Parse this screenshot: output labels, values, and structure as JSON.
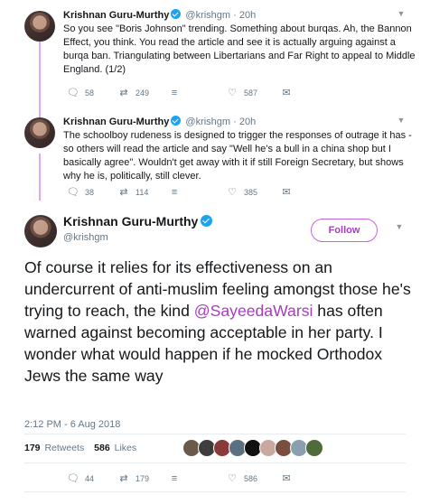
{
  "tweets": [
    {
      "name": "Krishnan Guru-Murthy",
      "handle": "@krishgm",
      "time": "20h",
      "text": "So you see \"Boris Johnson\" trending. Something about burqas. Ah, the Bannon Effect, you think. You read the article and see it is actually arguing against a burqa ban. Triangulating between Libertarians and Far Right to appeal to Middle England. (1/2)",
      "replies": "58",
      "retweets": "249",
      "likes": "587"
    },
    {
      "name": "Krishnan Guru-Murthy",
      "handle": "@krishgm",
      "time": "20h",
      "text": "The schoolboy rudeness is designed to trigger the responses of outrage it has - so others will read the article and say \"Well he's a bull in a china shop but I basically agree\". Wouldn't get away with it if still Foreign Secretary, but shows why he is, politically, still clever.",
      "replies": "38",
      "retweets": "114",
      "likes": "385"
    }
  ],
  "main": {
    "name": "Krishnan Guru-Murthy",
    "handle": "@krishgm",
    "follow_label": "Follow",
    "text_before": "Of course it relies for its effectiveness on an undercurrent of anti-muslim feeling amongst those he's trying to reach, the kind ",
    "mention": "@SayeedaWarsi",
    "text_after": " has often warned against becoming acceptable in her party. I wonder what would happen if he mocked Orthodox Jews the same way",
    "timestamp": "2:12 PM - 6 Aug 2018",
    "retweets_count": "179",
    "retweets_label": "Retweets",
    "likes_count": "586",
    "likes_label": "Likes",
    "replies": "44",
    "retweets": "179",
    "likes": "586"
  },
  "icons": {
    "reply": "reply-icon",
    "retweet": "retweet-icon",
    "like": "heart-icon",
    "dm": "stack-icon",
    "mail": "envelope-icon",
    "caret": "chevron-down-icon",
    "verified": "verified-badge-icon"
  },
  "colors": {
    "accent": "#a63bbf",
    "thread_line": "#e1a7ef",
    "muted": "#657786",
    "verified": "#1da1f2"
  }
}
